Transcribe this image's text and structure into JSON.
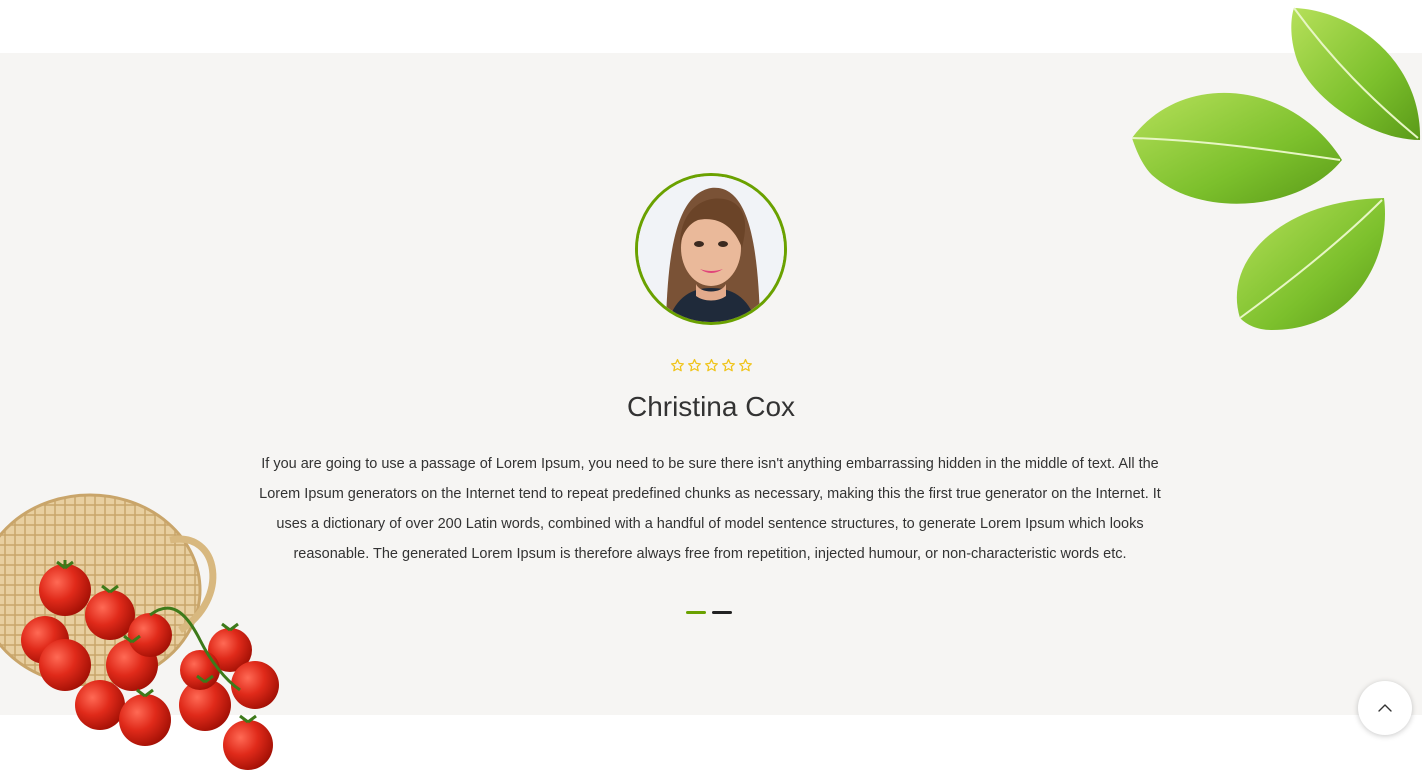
{
  "testimonial": {
    "rating_value": 5,
    "rating_max": 5,
    "name": "Christina Cox",
    "quote": "If you are going to use a passage of Lorem Ipsum, you need to be sure there isn't anything embarrassing hidden in the middle of text. All the Lorem Ipsum generators on the Internet tend to repeat predefined chunks as necessary, making this the first true generator on the Internet. It uses a dictionary of over 200 Latin words, combined with a handful of model sentence structures, to generate Lorem Ipsum which looks reasonable. The generated Lorem Ipsum is therefore always free from repetition, injected humour, or non-characteristic words etc."
  },
  "slider": {
    "slide_count": 2,
    "active_index": 0
  },
  "icons": {
    "star": "star-outline-icon",
    "scroll_top": "chevron-up-icon"
  },
  "colors": {
    "accent": "#6aa100",
    "star": "#f0c419",
    "band_background": "#f6f5f3",
    "text": "#333333"
  }
}
